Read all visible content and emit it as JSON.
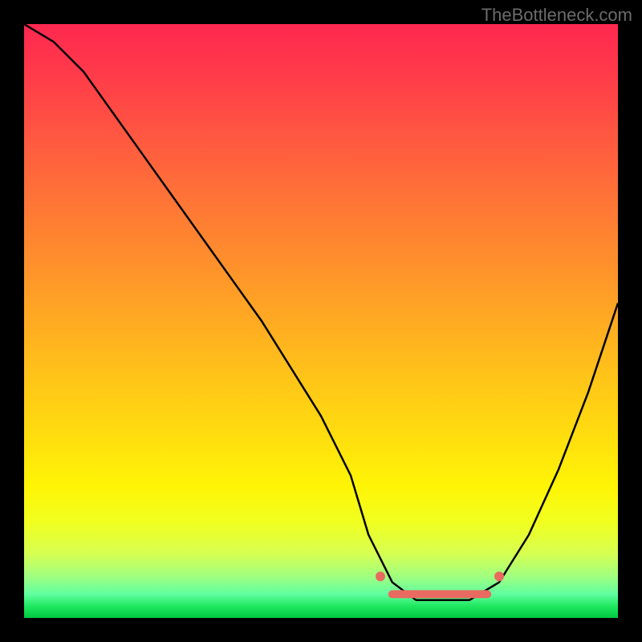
{
  "attribution": "TheBottleneck.com",
  "chart_data": {
    "type": "line",
    "title": "",
    "xlabel": "",
    "ylabel": "",
    "xlim": [
      0,
      100
    ],
    "ylim": [
      0,
      100
    ],
    "series": [
      {
        "name": "bottleneck-curve",
        "x": [
          0,
          5,
          10,
          15,
          20,
          25,
          30,
          35,
          40,
          45,
          50,
          55,
          58,
          62,
          66,
          70,
          75,
          80,
          85,
          90,
          95,
          100
        ],
        "y": [
          100,
          97,
          92,
          85,
          78,
          71,
          64,
          57,
          50,
          42,
          34,
          24,
          14,
          6,
          3,
          3,
          3,
          6,
          14,
          25,
          38,
          53
        ]
      }
    ],
    "markers": [
      {
        "name": "plateau-left-marker",
        "x": 60,
        "y": 7,
        "color": "#e86a60"
      },
      {
        "name": "plateau-right-marker",
        "x": 80,
        "y": 7,
        "color": "#e86a60"
      },
      {
        "name": "plateau-fill",
        "x_from": 62,
        "x_to": 78,
        "y": 4,
        "color": "#e86a60"
      }
    ],
    "gradient_stops": [
      {
        "pos": 0,
        "color": "#ff2850"
      },
      {
        "pos": 50,
        "color": "#ffc01a"
      },
      {
        "pos": 80,
        "color": "#fff506"
      },
      {
        "pos": 100,
        "color": "#00c840"
      }
    ]
  }
}
